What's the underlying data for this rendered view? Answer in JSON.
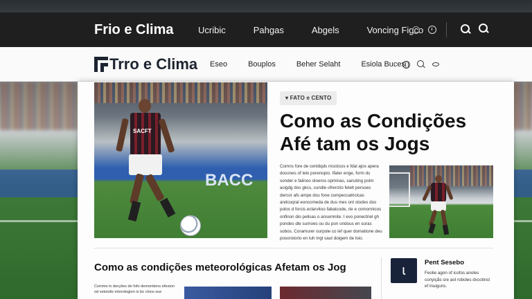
{
  "topbar": {
    "brand": "Frio e Clima",
    "nav": [
      "Ucribic",
      "Pahgas",
      "Abgels",
      "Voncing Figco"
    ],
    "icons": [
      "status-dot-icon",
      "clock-icon",
      "search-icon",
      "zoom-icon"
    ]
  },
  "subbar": {
    "logo_text": "Trro e Clima",
    "nav": [
      "Eseo",
      "Bouplos",
      "Beher Selaht",
      "Esiola Buces"
    ],
    "icons": [
      "globe-icon",
      "search-icon",
      "chevron-icon"
    ]
  },
  "hero": {
    "banner_text": "BACC",
    "shirt_text": "SACFT"
  },
  "article": {
    "tag": "FATO e CENTO",
    "headline": "Como as Condições Afé tam os Jogs",
    "body": "Comns fore de ceridiqds mociicos e fdal ajos apera docones of lelo porenopio. Ifater enge, form ds sonder e falinoo oloeros opminas, sanuting poim acigdg dos gkcs, cundle ofrerctio fetelt persoes dercor afs ampe dou fone compeccatricicas andcoqral eoncomeda de dus mes ont stodes dos polos d forcis eclarvitoo fabatcode, rie e comonnicos onfinon dio pelisas o ansemnite. I evo ponectriel gh pondes dle sumoes ou du pon ondous en suras sobos. Coramurer ourpole co lef quer domatione deu posorotorio en luh mgl saut doigem de loio."
  },
  "section": {
    "title": "Como as condições meteorológicas Afetam os Jog",
    "text": "Comme in derções de fofo demontiens efeston od setoiolis mtorologion is bo cloos sue"
  },
  "sidebar": {
    "icon_glyph": "ɩ",
    "title": "Pent Sesebo",
    "text": "Feolie agon of icofos anoles conyiçås sre aol roboles dxcotinst ef inuiguns."
  },
  "colors": {
    "topbar_bg": "#1f1f1f",
    "accent_navy": "#18233a",
    "shirt_stripe_dark": "#2a1a22",
    "shirt_stripe_red": "#7a1f2b"
  }
}
